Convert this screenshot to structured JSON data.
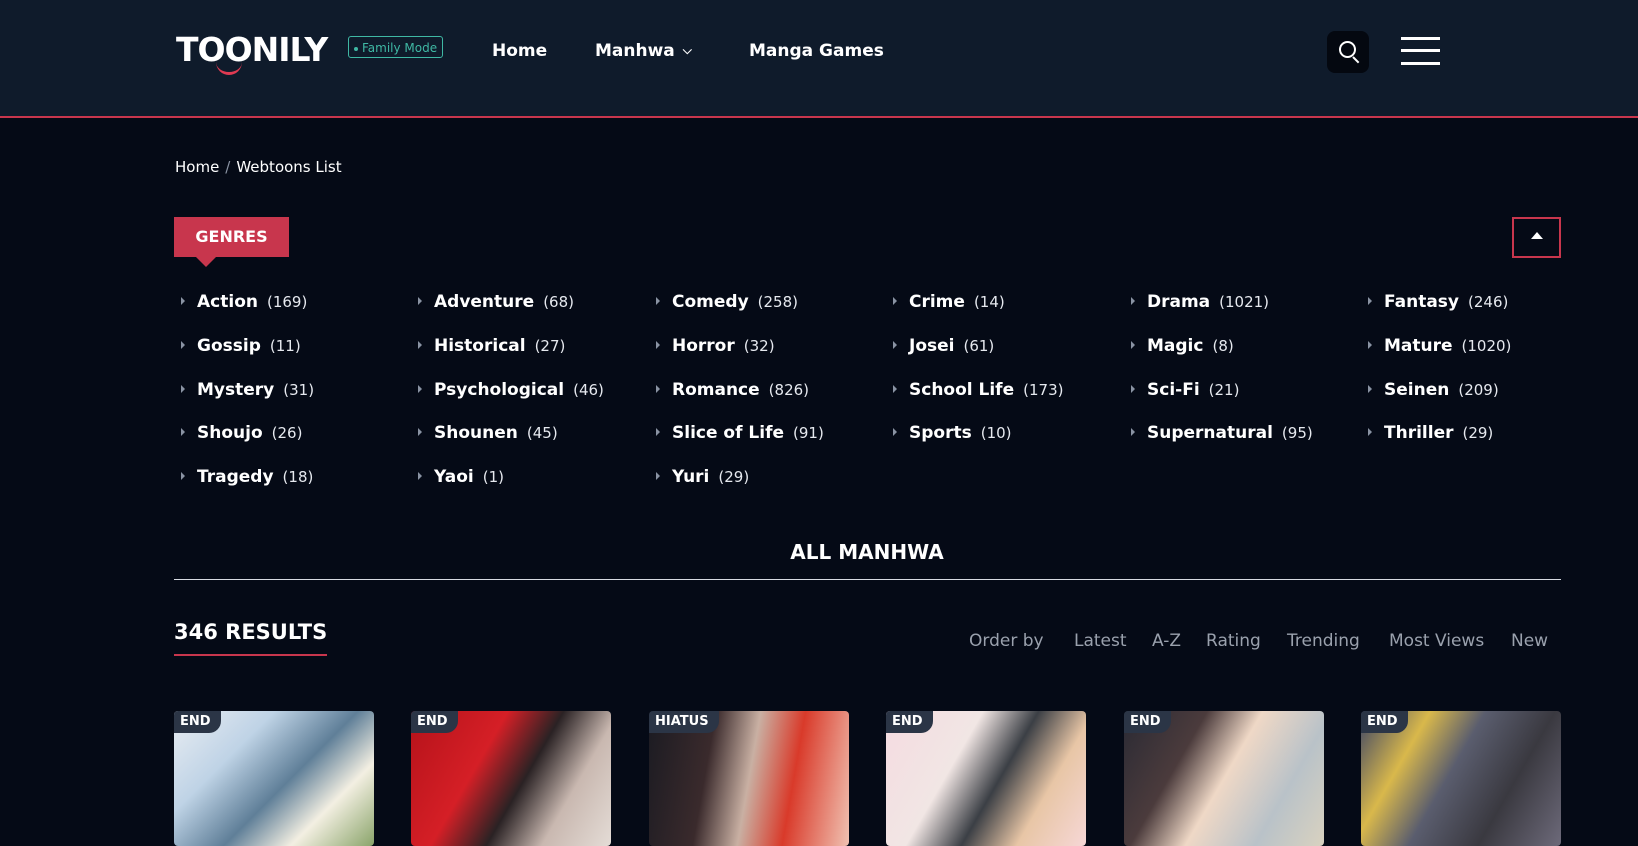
{
  "header": {
    "logo": "TOONILY",
    "family_mode": "Family Mode",
    "nav": [
      {
        "label": "Home"
      },
      {
        "label": "Manhwa"
      },
      {
        "label": "Manga Games"
      }
    ]
  },
  "breadcrumb": {
    "home": "Home",
    "separator": "/",
    "current": "Webtoons List"
  },
  "genres": {
    "title": "GENRES",
    "items": [
      {
        "name": "Action",
        "count": "(169)"
      },
      {
        "name": "Adventure",
        "count": "(68)"
      },
      {
        "name": "Comedy",
        "count": "(258)"
      },
      {
        "name": "Crime",
        "count": "(14)"
      },
      {
        "name": "Drama",
        "count": "(1021)"
      },
      {
        "name": "Fantasy",
        "count": "(246)"
      },
      {
        "name": "Gossip",
        "count": "(11)"
      },
      {
        "name": "Historical",
        "count": "(27)"
      },
      {
        "name": "Horror",
        "count": "(32)"
      },
      {
        "name": "Josei",
        "count": "(61)"
      },
      {
        "name": "Magic",
        "count": "(8)"
      },
      {
        "name": "Mature",
        "count": "(1020)"
      },
      {
        "name": "Mystery",
        "count": "(31)"
      },
      {
        "name": "Psychological",
        "count": "(46)"
      },
      {
        "name": "Romance",
        "count": "(826)"
      },
      {
        "name": "School Life",
        "count": "(173)"
      },
      {
        "name": "Sci-Fi",
        "count": "(21)"
      },
      {
        "name": "Seinen",
        "count": "(209)"
      },
      {
        "name": "Shoujo",
        "count": "(26)"
      },
      {
        "name": "Shounen",
        "count": "(45)"
      },
      {
        "name": "Slice of Life",
        "count": "(91)"
      },
      {
        "name": "Sports",
        "count": "(10)"
      },
      {
        "name": "Supernatural",
        "count": "(95)"
      },
      {
        "name": "Thriller",
        "count": "(29)"
      },
      {
        "name": "Tragedy",
        "count": "(18)"
      },
      {
        "name": "Yaoi",
        "count": "(1)"
      },
      {
        "name": "Yuri",
        "count": "(29)"
      }
    ]
  },
  "all_title": "ALL MANHWA",
  "results": "346 RESULTS",
  "order": {
    "label": "Order by",
    "options": [
      "Latest",
      "A-Z",
      "Rating",
      "Trending",
      "Most Views",
      "New"
    ]
  },
  "cards": [
    {
      "status": "END"
    },
    {
      "status": "END"
    },
    {
      "status": "HIATUS"
    },
    {
      "status": "END"
    },
    {
      "status": "END"
    },
    {
      "status": "END"
    }
  ],
  "colors": {
    "accent": "#c8364d",
    "header_bg": "#0f1b2b",
    "page_bg": "#050a16",
    "family_mode": "#3fb8a4"
  }
}
